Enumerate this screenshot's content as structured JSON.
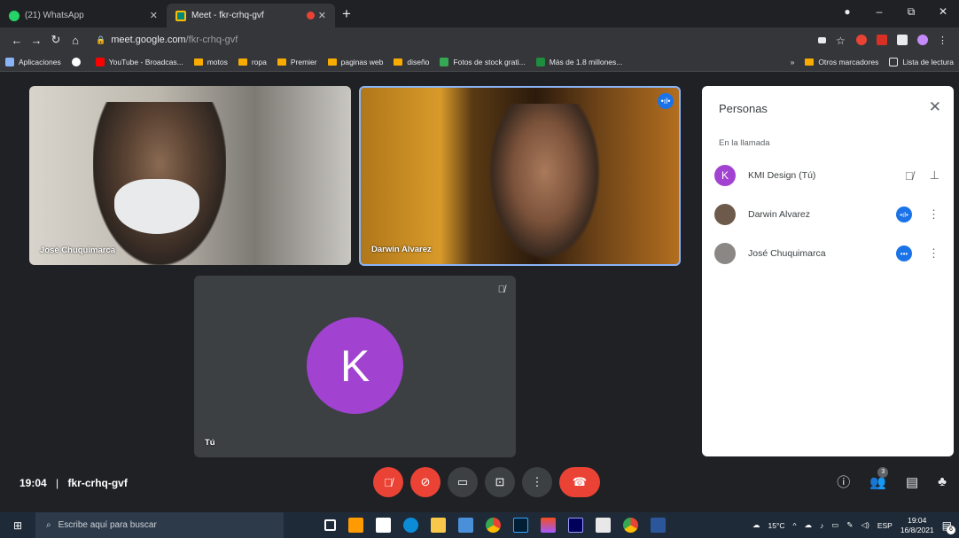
{
  "browser": {
    "tabs": [
      {
        "title": "(21) WhatsApp",
        "active": false
      },
      {
        "title": "Meet - fkr-crhq-gvf",
        "active": true
      }
    ],
    "new_tab": "+",
    "window_controls": {
      "minimize": "–",
      "restore": "⧉",
      "close": "✕"
    },
    "address": {
      "host": "meet.google.com",
      "path": "/fkr-crhq-gvf"
    },
    "bookmarks": [
      {
        "label": "Aplicaciones",
        "icon": "apps-grid-icon"
      },
      {
        "label": "",
        "icon": "google-icon"
      },
      {
        "label": "YouTube - Broadcas...",
        "icon": "youtube-icon"
      },
      {
        "label": "motos",
        "icon": "folder-icon"
      },
      {
        "label": "ropa",
        "icon": "folder-icon"
      },
      {
        "label": "Premier",
        "icon": "folder-icon"
      },
      {
        "label": "paginas web",
        "icon": "folder-icon"
      },
      {
        "label": "diseño",
        "icon": "folder-icon"
      },
      {
        "label": "Fotos de stock grati...",
        "icon": "stock-icon"
      },
      {
        "label": "Más de 1.8 millones...",
        "icon": "image-icon"
      }
    ],
    "bookmarks_overflow": "»",
    "other_bookmarks": "Otros marcadores",
    "reading_list": "Lista de lectura"
  },
  "meeting": {
    "tiles": [
      {
        "name": "José Chuquimarca"
      },
      {
        "name": "Darwin Alvarez"
      },
      {
        "name": "Tú",
        "avatar_letter": "K",
        "avatar_color": "#a142d1"
      }
    ],
    "time": "19:04",
    "code": "fkr-crhq-gvf",
    "participants_count": "3"
  },
  "panel": {
    "title": "Personas",
    "section": "En la llamada",
    "people": [
      {
        "name": "KMI Design (Tú)",
        "avatar_letter": "K",
        "avatar_color": "#a142d1"
      },
      {
        "name": "Darwin Alvarez",
        "avatar_letter": "",
        "avatar_color": "#6d5a4a"
      },
      {
        "name": "José Chuquimarca",
        "avatar_letter": "",
        "avatar_color": "#8a8784"
      }
    ]
  },
  "taskbar": {
    "search_placeholder": "Escribe aquí para buscar",
    "weather": "15°C",
    "language": "ESP",
    "time": "19:04",
    "date": "16/8/2021",
    "notifications": "6"
  }
}
